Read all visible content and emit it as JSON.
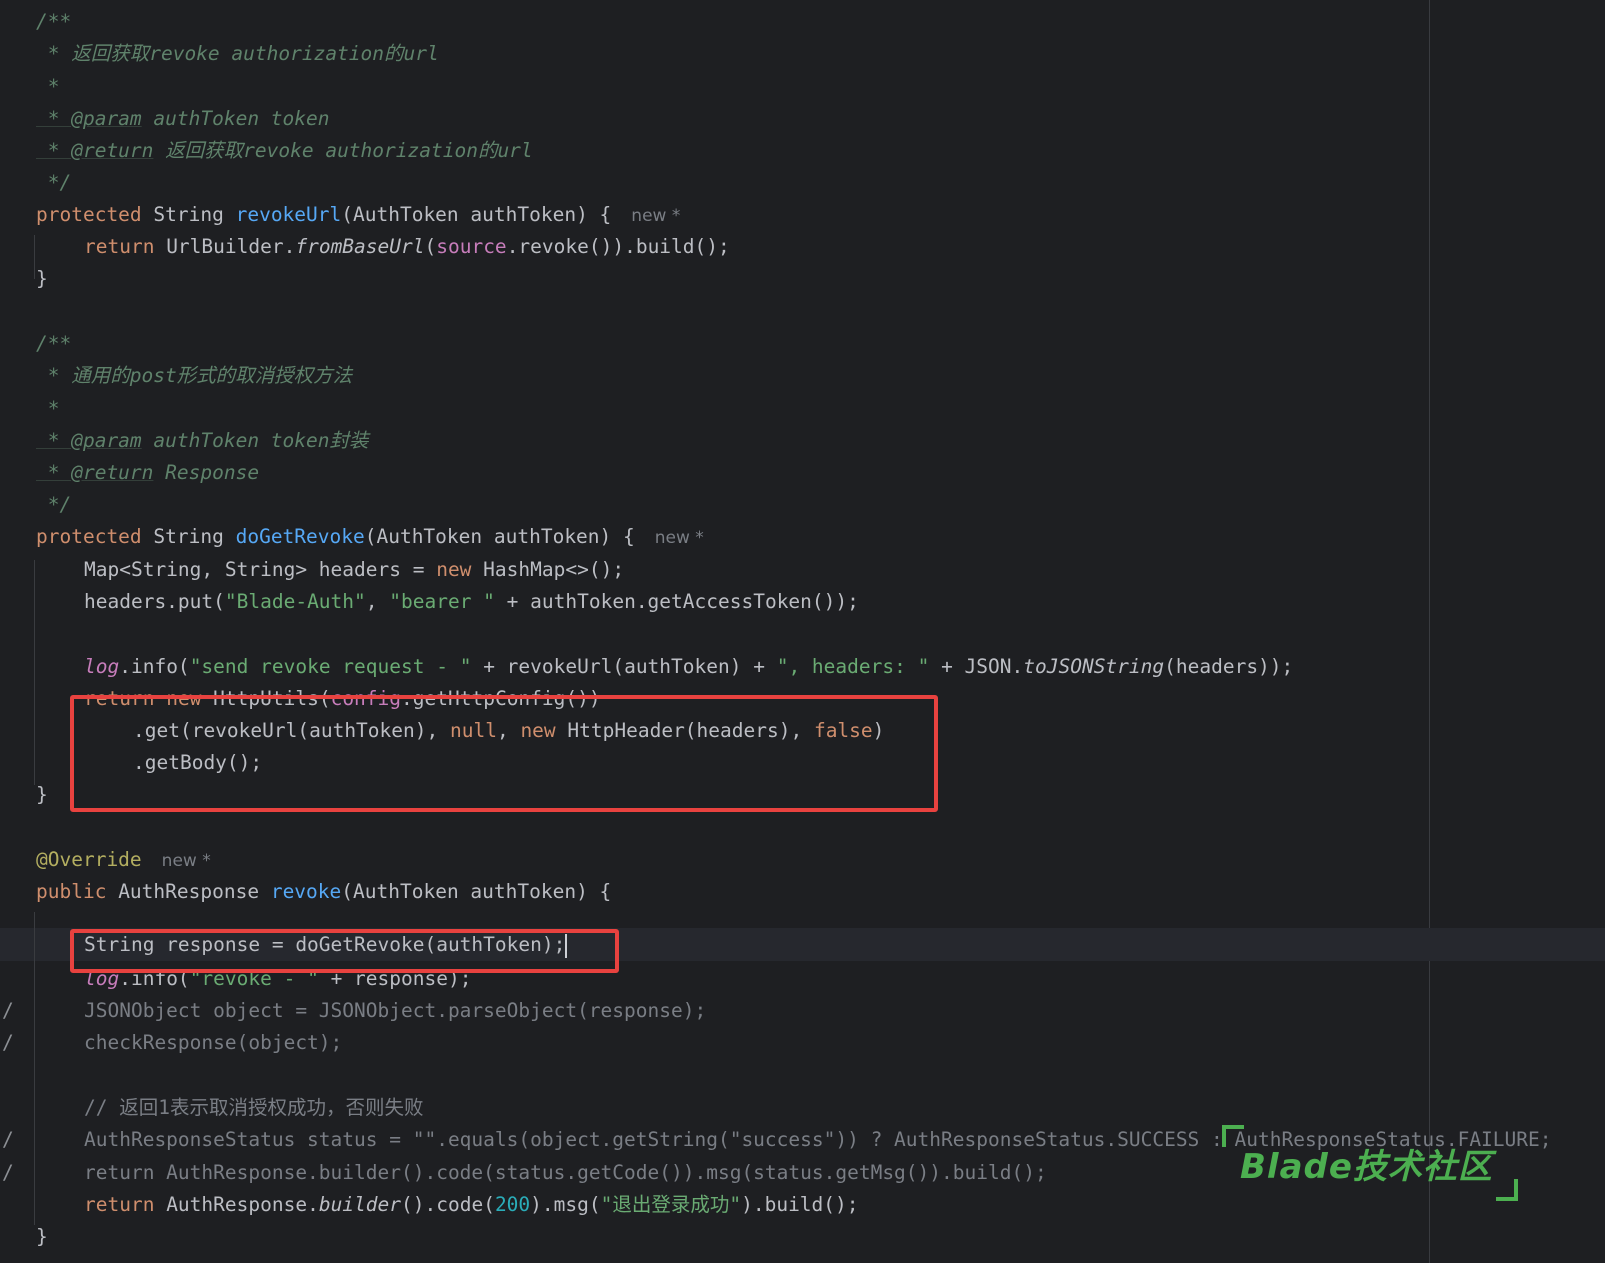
{
  "lines": {
    "l01": "/**",
    "l02": " * 返回获取revoke authorization的url",
    "l03": " *",
    "l04_tag": " * @param",
    "l04_text": " authToken token",
    "l05_tag": " * @return",
    "l05_text": " 返回获取revoke authorization的url",
    "l06": " */",
    "l07_kw": "protected",
    "l07_type": " String ",
    "l07_fn": "revokeUrl",
    "l07_rest": "(AuthToken authToken) {",
    "l07_hint": "new *",
    "l08_kw": "return",
    "l08_a": " UrlBuilder.",
    "l08_b": "fromBaseUrl",
    "l08_c": "(",
    "l08_d": "source",
    "l08_e": ".revoke()).build();",
    "l09": "}",
    "l11": "/**",
    "l12": " * 通用的post形式的取消授权方法",
    "l13": " *",
    "l14_tag": " * @param",
    "l14_text": " authToken token封装",
    "l15_tag": " * @return",
    "l15_text": " Response",
    "l16": " */",
    "l17_kw": "protected",
    "l17_type": " String ",
    "l17_fn": "doGetRevoke",
    "l17_rest": "(AuthToken authToken) {",
    "l17_hint": "new *",
    "l18_a": "Map<String, String> headers = ",
    "l18_kw": "new",
    "l18_b": " HashMap<>();",
    "l19_a": "headers.put(",
    "l19_s1": "\"Blade-Auth\"",
    "l19_b": ", ",
    "l19_s2": "\"bearer \"",
    "l19_c": " + authToken.getAccessToken());",
    "l21_log": "log",
    "l21_a": ".info(",
    "l21_s1": "\"send revoke request - \"",
    "l21_b": " + revokeUrl(authToken) + ",
    "l21_s2": "\", headers: \"",
    "l21_c": " + JSON.",
    "l21_d": "toJSONString",
    "l21_e": "(headers));",
    "l22_kw1": "return",
    "l22_kw2": "new",
    "l22_a": " HttpUtils(",
    "l22_fld": "config",
    "l22_b": ".getHttpConfig())",
    "l23_a": ".get(revokeUrl(authToken), ",
    "l23_kw1": "null",
    "l23_b": ", ",
    "l23_kw2": "new",
    "l23_c": " HttpHeader(headers), ",
    "l23_kw3": "false",
    "l23_d": ")",
    "l24": ".getBody();",
    "l25": "}",
    "l27_ann": "@Override",
    "l27_hint": "new *",
    "l28_kw": "public",
    "l28_type": " AuthResponse ",
    "l28_fn": "revoke",
    "l28_rest": "(AuthToken authToken) {",
    "l29": "String response = doGetRevoke(authToken);",
    "l30_log": "log",
    "l30_a": ".info(",
    "l30_s": "\"revoke - \"",
    "l30_b": " + response);",
    "l31": "JSONObject object = JSONObject.parseObject(response);",
    "l32": "checkResponse(object);",
    "l34": "// 返回1表示取消授权成功，否则失败",
    "l35": "AuthResponseStatus status = \"\".equals(object.getString(\"success\")) ? AuthResponseStatus.SUCCESS : AuthResponseStatus.FAILURE;",
    "l36": "return AuthResponse.builder().code(status.getCode()).msg(status.getMsg()).build();",
    "l37_kw": "return",
    "l37_a": " AuthResponse.",
    "l37_b": "builder",
    "l37_c": "().code(",
    "l37_num": "200",
    "l37_d": ").msg(",
    "l37_s": "\"退出登录成功\"",
    "l37_e": ").build();",
    "l38": "}",
    "slash": "/"
  },
  "watermark": {
    "text": "Blade技术社区"
  },
  "colors": {
    "background": "#1e1f22",
    "highlight_box": "#e8423f",
    "watermark": "#4caf50"
  }
}
